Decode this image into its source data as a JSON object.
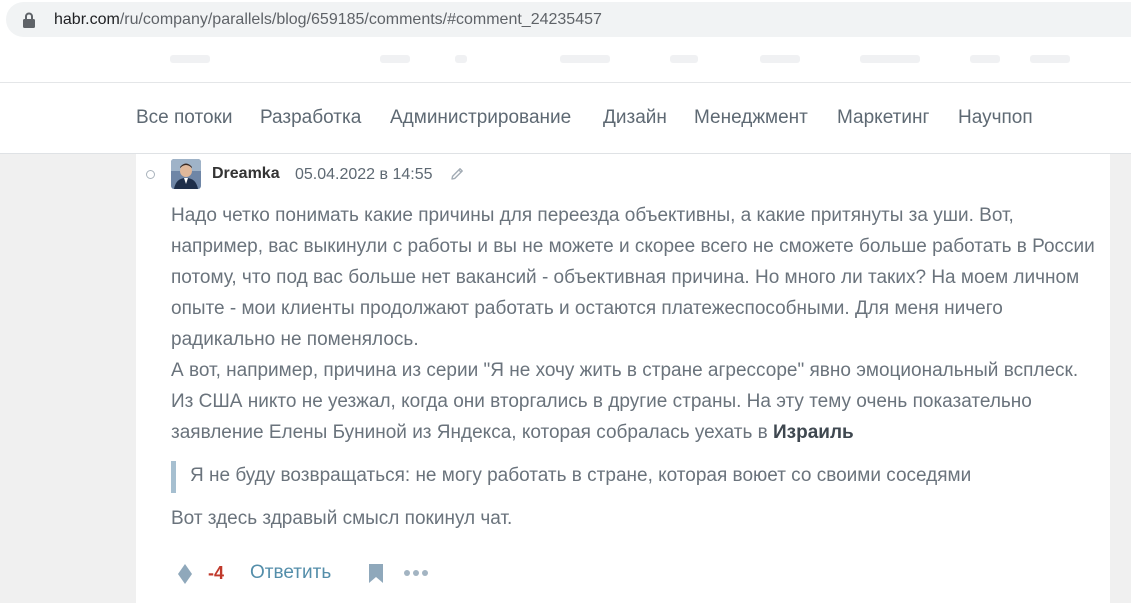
{
  "browser": {
    "url_host": "habr.com",
    "url_path": "/ru/company/parallels/blog/659185/comments/#comment_24235457",
    "lock_icon": "lock-icon"
  },
  "nav": {
    "items": [
      {
        "label": "Все потоки"
      },
      {
        "label": "Разработка"
      },
      {
        "label": "Администрирование"
      },
      {
        "label": "Дизайн"
      },
      {
        "label": "Менеджмент"
      },
      {
        "label": "Маркетинг"
      },
      {
        "label": "Научпоп"
      }
    ]
  },
  "comment": {
    "author": "Dreamka",
    "timestamp": "05.04.2022 в 14:55",
    "paragraph1": "Надо четко понимать какие причины для переезда объективны, а какие притянуты за уши. Вот, например, вас выкинули с работы и вы не можете и скорее всего не сможете больше работать в России потому, что под вас больше нет вакансий - объективная причина. Но много ли таких? На моем личном опыте - мои клиенты продолжают работать и остаются платежеспособными. Для меня ничего радикально не поменялось.",
    "paragraph2_text": "А вот, например, причина из серии \"Я не хочу жить в стране агрессоре\" явно эмоциональный всплеск. Из США никто не уезжал, когда они вторгались в другие страны. На эту тему очень показательно заявление Елены Буниной из Яндекса, которая собралась уехать в ",
    "paragraph2_bold": "Израиль",
    "quote": "Я не буду возвращаться: не могу работать в стране, которая воюет со своими соседями",
    "closing": "Вот здесь здравый смысл покинул чат.",
    "score": "-4",
    "reply_label": "Ответить"
  },
  "colors": {
    "nav_text": "#5e6973",
    "body_text": "#6a737c",
    "link": "#548eaa",
    "negative_score": "#c0392b",
    "quote_bar": "#a6bfd0",
    "page_bg": "#f0f0f0"
  },
  "icons": [
    "lock-icon",
    "edit-icon",
    "vote-icon",
    "bookmark-icon",
    "more-icon"
  ]
}
